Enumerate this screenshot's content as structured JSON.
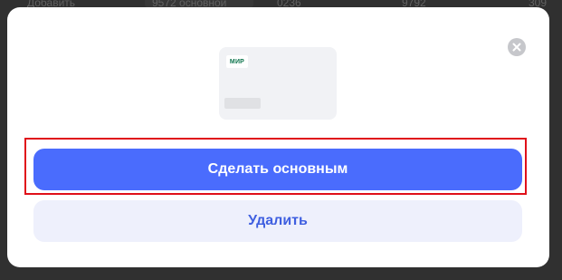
{
  "background": {
    "row_texts": [
      "Добавить",
      "9572 основной",
      "0236",
      "9792",
      "309"
    ]
  },
  "modal": {
    "card": {
      "brand": "МИР"
    },
    "buttons": {
      "make_default": "Сделать основным",
      "delete": "Удалить"
    },
    "colors": {
      "primary": "#4a6cfd",
      "secondary_bg": "#eef0fc",
      "highlight": "#e0101a"
    }
  }
}
